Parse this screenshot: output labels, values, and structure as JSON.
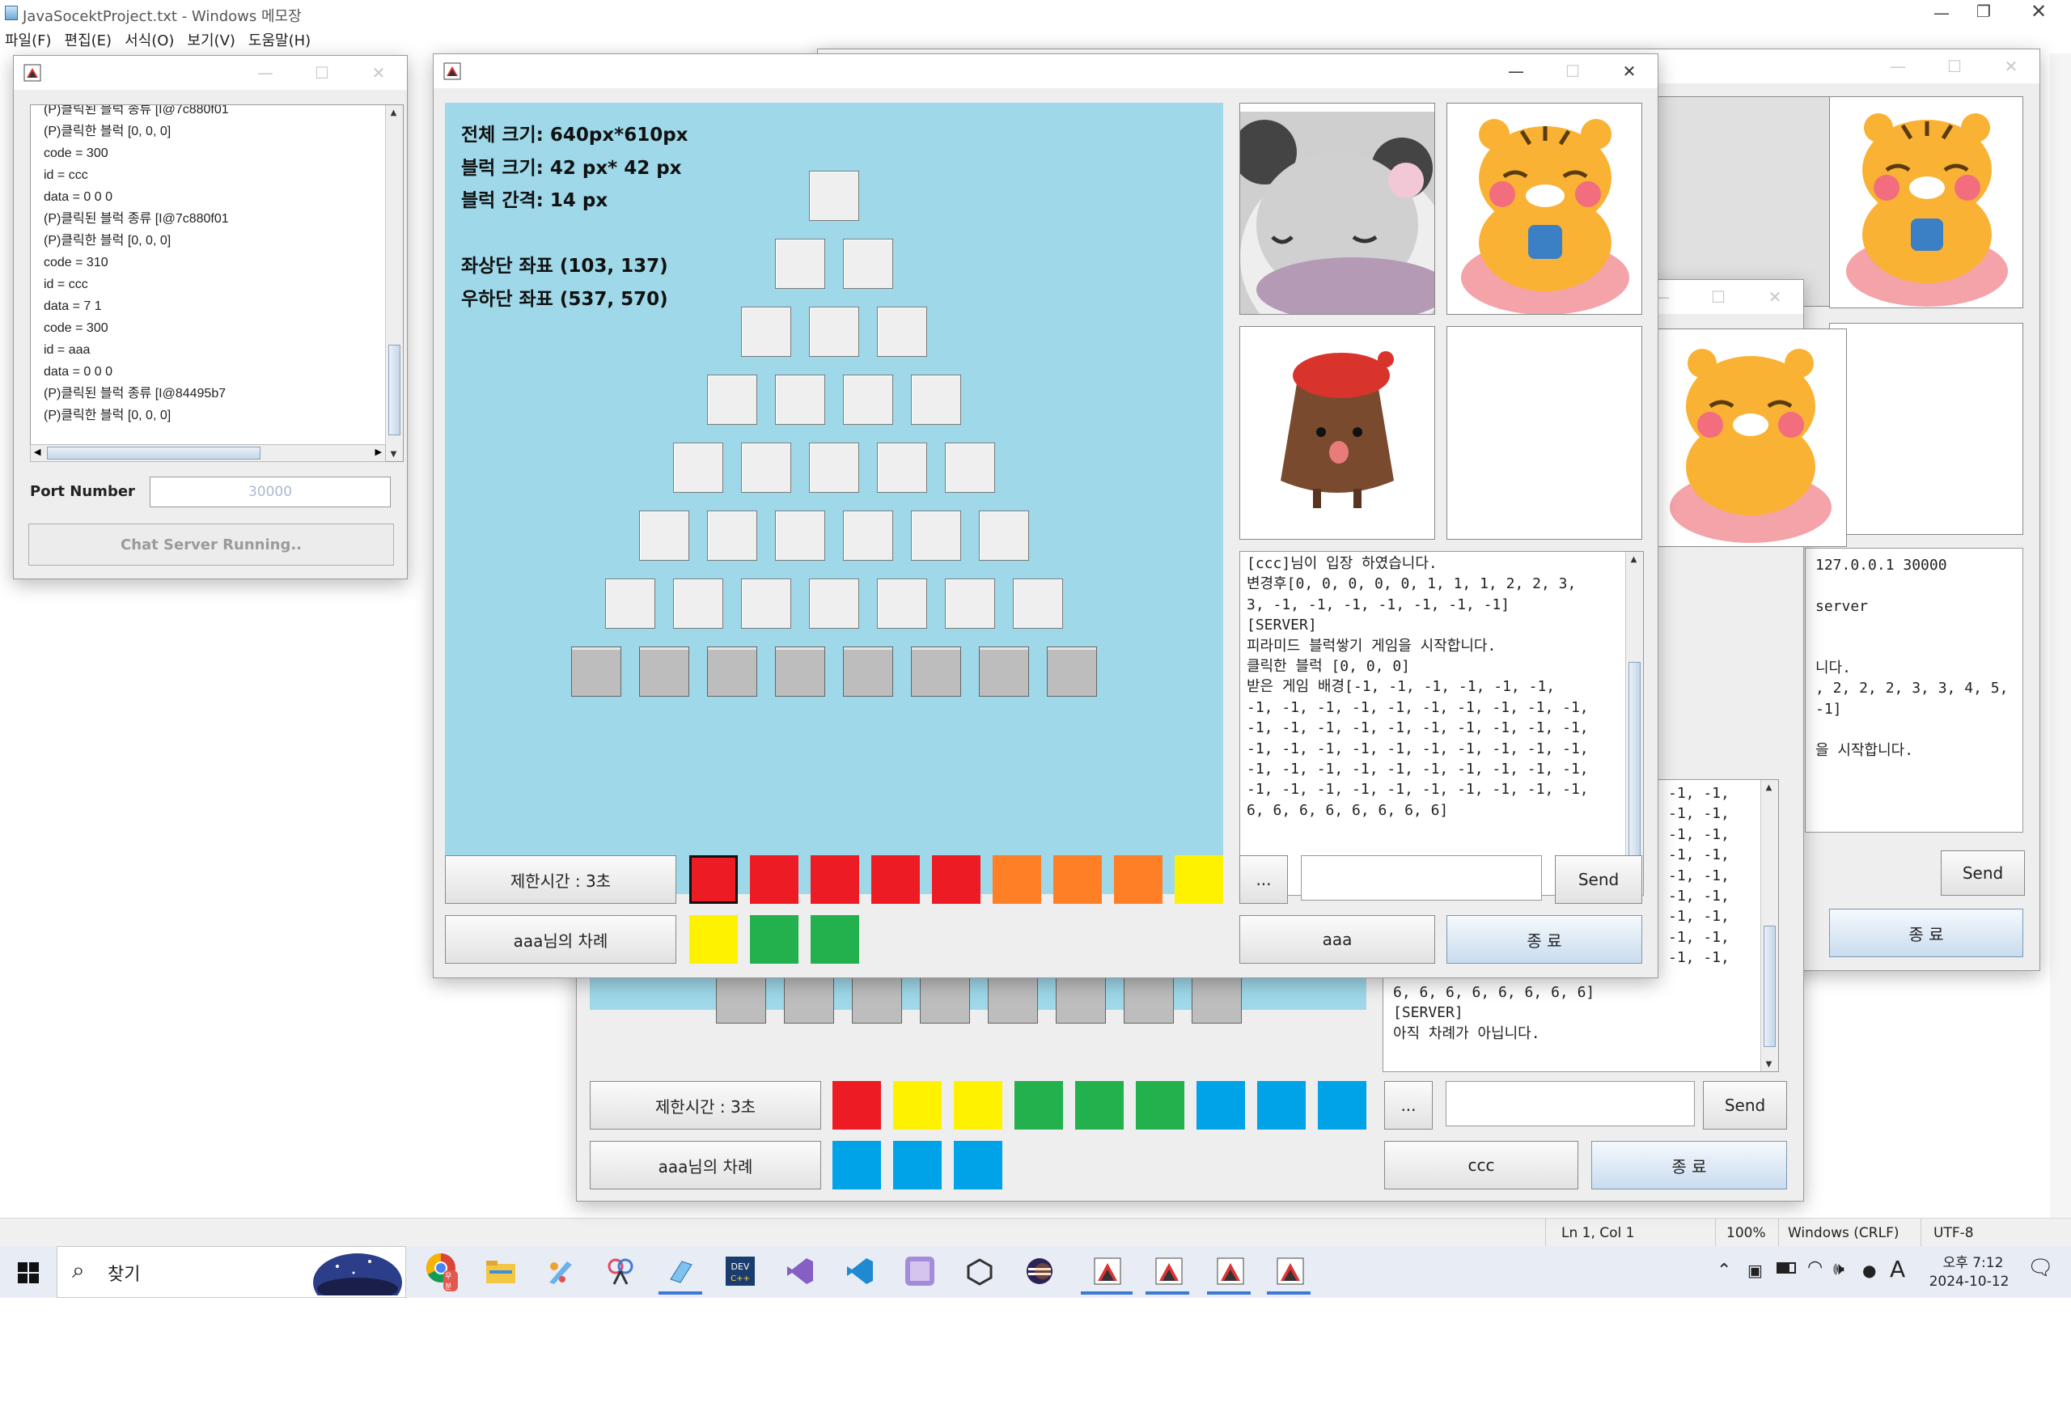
{
  "notepad": {
    "title": "JavaSocektProject.txt - Windows 메모장",
    "menus": [
      "파일(F)",
      "편집(E)",
      "서식(O)",
      "보기(V)",
      "도움말(H)"
    ],
    "status": {
      "position": "Ln 1, Col 1",
      "zoom": "100%",
      "eol": "Windows (CRLF)",
      "encoding": "UTF-8"
    }
  },
  "server": {
    "log_lines": [
      "(P)클릭된 블럭 종류 [I@7c880f01",
      "(P)클릭한 블럭 [0, 0, 0]",
      "code = 300",
      "id = ccc",
      "data = 0 0 0",
      "(P)클릭된 블럭 종류 [I@7c880f01",
      "(P)클릭한 블럭 [0, 0, 0]",
      "code = 310",
      "id = ccc",
      "data = 7 1",
      "code = 300",
      "id = aaa",
      "data = 0 0 0",
      "(P)클릭된 블럭 종류 [I@84495b7",
      "(P)클릭한 블럭 [0, 0, 0]"
    ],
    "port_label": "Port Number",
    "port_value": "30000",
    "button": "Chat Server Running.."
  },
  "main": {
    "info": [
      "전체 크기: 640px*610px",
      "블럭 크기: 42 px* 42 px",
      "블럭 간격: 14 px",
      "",
      "좌상단 좌표 (103, 137)",
      "우하단 좌표 (537, 570)"
    ],
    "time_label": "제한시간 : 3초",
    "turn_label": "aaa님의 차례",
    "chat": [
      "[ccc]님이 입장 하였습니다.",
      "변경후[0, 0, 0, 0, 0, 1, 1, 1, 2, 2, 3,",
      "3, -1, -1, -1, -1, -1, -1, -1]",
      "[SERVER]",
      "피라미드 블럭쌓기 게임을 시작합니다.",
      "클릭한 블럭 [0, 0, 0]",
      "받은 게임 배경[-1, -1, -1, -1, -1, -1,",
      "-1, -1, -1, -1, -1, -1, -1, -1, -1, -1,",
      "-1, -1, -1, -1, -1, -1, -1, -1, -1, -1,",
      "-1, -1, -1, -1, -1, -1, -1, -1, -1, -1,",
      "-1, -1, -1, -1, -1, -1, -1, -1, -1, -1,",
      "-1, -1, -1, -1, -1, -1, -1, -1, -1, -1,",
      "6, 6, 6, 6, 6, 6, 6, 6]"
    ],
    "more_btn": "...",
    "send_btn": "Send",
    "user_btn": "aaa",
    "exit_btn": "종 료",
    "colors_row1": [
      "#ed1c24",
      "#ed1c24",
      "#ed1c24",
      "#ed1c24",
      "#ed1c24",
      "#ff7f27",
      "#ff7f27",
      "#ff7f27",
      "#fff200"
    ],
    "colors_row2": [
      "#fff200",
      "#22b14c",
      "#22b14c"
    ]
  },
  "win2": {
    "time_label": "제한시간 : 3초",
    "turn_label": "aaa님의 차례",
    "chat": [
      "6, 6, 6, 6, 6, 6, 6, 6]",
      "[SERVER]",
      "아직 차례가 아닙니다."
    ],
    "chat_frag": [
      "-1, -1,",
      "-1, -1,",
      "-1, -1,",
      "-1, -1,",
      "-1, -1,",
      "-1, -1,",
      "-1, -1,",
      "-1, -1,",
      "-1, -1,"
    ],
    "more_btn": "...",
    "send_btn": "Send",
    "user_btn": "ccc",
    "exit_btn": "종 료",
    "colors_row1": [
      "#ed1c24",
      "#fff200",
      "#fff200",
      "#22b14c",
      "#22b14c",
      "#22b14c",
      "#00a2e8",
      "#00a2e8",
      "#00a2e8"
    ],
    "colors_row2": [
      "#00a2e8",
      "#00a2e8",
      "#00a2e8"
    ]
  },
  "win3": {
    "chat_frag": [
      "127.0.0.1 30000",
      "",
      "server",
      "",
      "",
      "니다.",
      ", 2, 2, 2, 3, 3, 4, 5,",
      "-1]",
      "",
      "을 시작합니다."
    ],
    "send_btn": "Send",
    "exit_btn": "종 료"
  },
  "taskbar": {
    "search_placeholder": "찾기",
    "time": "오후 7:12",
    "date": "2024-10-12",
    "ime": "A"
  },
  "icons": {
    "chrome_badge": "우분"
  }
}
